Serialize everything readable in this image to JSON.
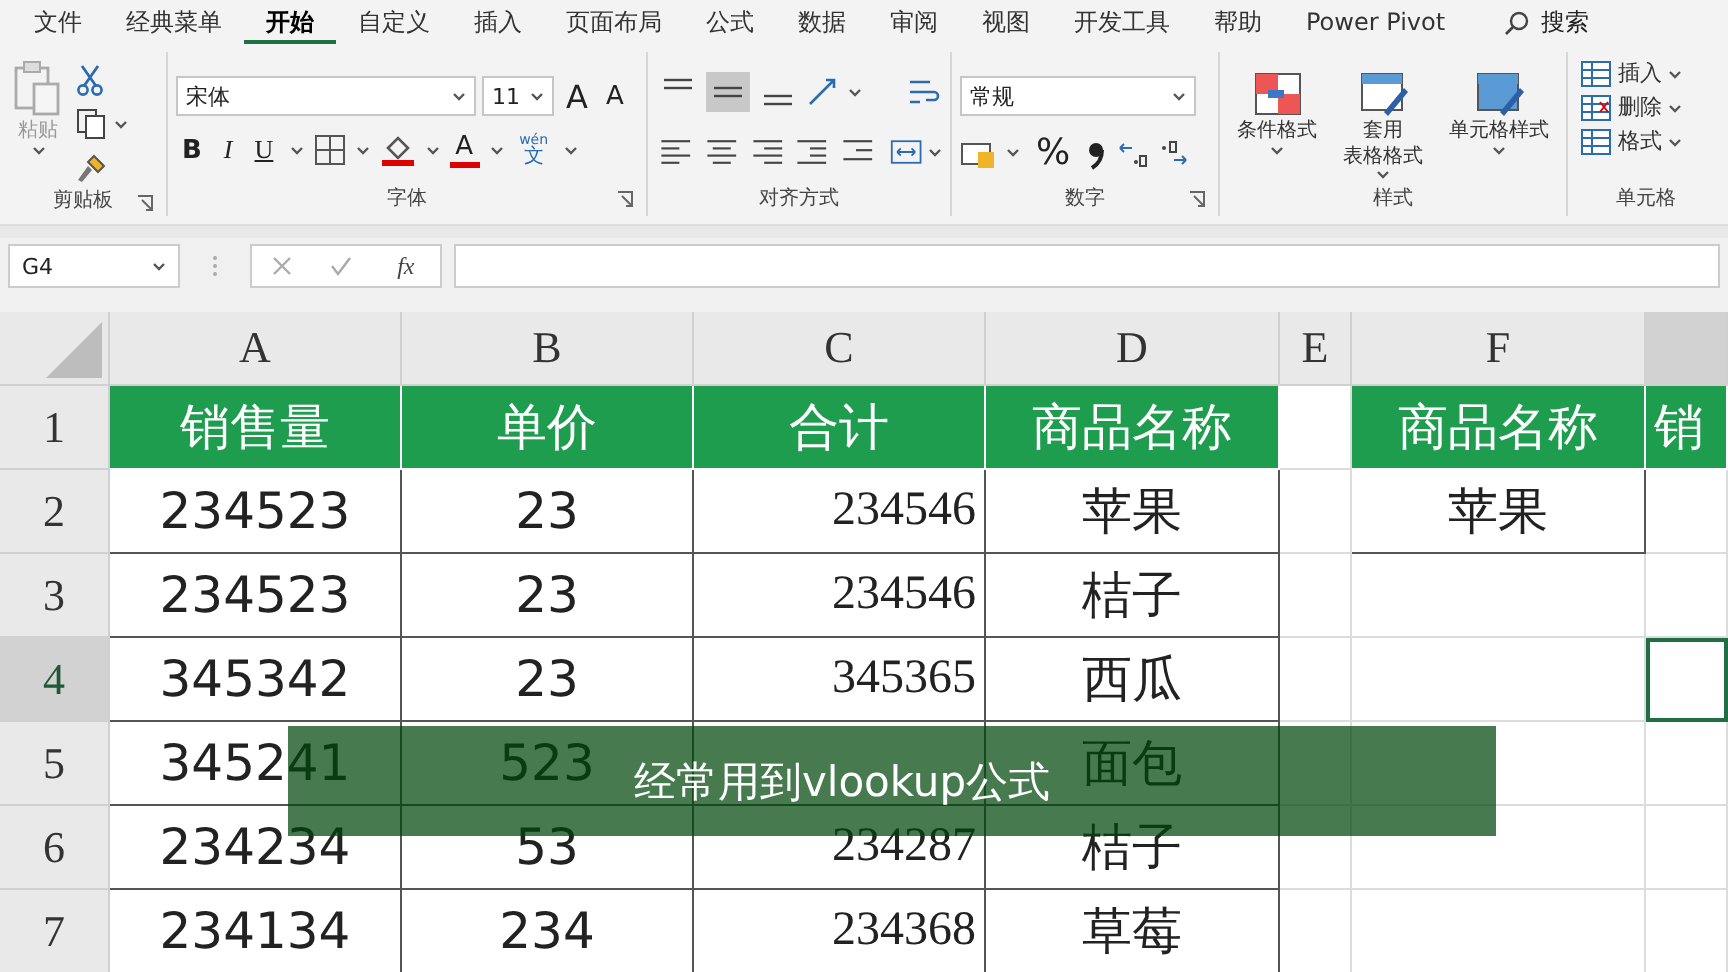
{
  "tabs": [
    {
      "label": "文件",
      "selected": false
    },
    {
      "label": "经典菜单",
      "selected": false
    },
    {
      "label": "开始",
      "selected": true
    },
    {
      "label": "自定义",
      "selected": false
    },
    {
      "label": "插入",
      "selected": false
    },
    {
      "label": "页面布局",
      "selected": false
    },
    {
      "label": "公式",
      "selected": false
    },
    {
      "label": "数据",
      "selected": false
    },
    {
      "label": "审阅",
      "selected": false
    },
    {
      "label": "视图",
      "selected": false
    },
    {
      "label": "开发工具",
      "selected": false
    },
    {
      "label": "帮助",
      "selected": false
    },
    {
      "label": "Power Pivot",
      "selected": false
    }
  ],
  "search": {
    "label": "搜索"
  },
  "ribbon": {
    "clipboard": {
      "title": "剪贴板",
      "paste_label": "粘贴",
      "paste_disabled": true
    },
    "font": {
      "title": "字体",
      "font_name": "宋体",
      "font_size": "11",
      "grow": "A",
      "shrink": "A",
      "bold": "B",
      "italic": "I",
      "underline": "U",
      "font_color": "A",
      "phonetic_top": "wén",
      "phonetic_bottom": "文"
    },
    "alignment": {
      "title": "对齐方式",
      "vertical": [
        {
          "selected": false
        },
        {
          "selected": true
        },
        {
          "selected": false
        }
      ]
    },
    "number": {
      "title": "数字",
      "format": "常规",
      "percent": "%"
    },
    "styles": {
      "title": "样式",
      "buttons": [
        {
          "lines": [
            "条件格式"
          ]
        },
        {
          "lines": [
            "套用",
            "表格格式"
          ]
        },
        {
          "lines": [
            "单元格样式"
          ]
        }
      ]
    },
    "cells": {
      "title": "单元格",
      "buttons": [
        {
          "label": "插入"
        },
        {
          "label": "删除"
        },
        {
          "label": "格式"
        }
      ]
    }
  },
  "formula_bar": {
    "name_box": "G4",
    "fx": "fx"
  },
  "sheet": {
    "columns": [
      {
        "label": "A",
        "selected": false
      },
      {
        "label": "B",
        "selected": false
      },
      {
        "label": "C",
        "selected": false
      },
      {
        "label": "D",
        "selected": false
      },
      {
        "label": "E",
        "selected": false
      },
      {
        "label": "F",
        "selected": false
      },
      {
        "selected": true
      }
    ],
    "rows": [
      {
        "number": "1",
        "kind": "header",
        "selected": false,
        "cells": [
          "销售量",
          "单价",
          "合计",
          "商品名称",
          null,
          "商品名称",
          "销"
        ]
      },
      {
        "number": "2",
        "kind": "data",
        "selected": false,
        "cells": [
          "234523",
          "23",
          "234546",
          "苹果",
          null,
          "苹果",
          null
        ]
      },
      {
        "number": "3",
        "kind": "data",
        "selected": false,
        "cells": [
          "234523",
          "23",
          "234546",
          "桔子",
          null,
          null,
          null
        ]
      },
      {
        "number": "4",
        "kind": "data",
        "selected": true,
        "cells": [
          "345342",
          "23",
          "345365",
          "西瓜",
          null,
          null,
          null
        ]
      },
      {
        "number": "5",
        "kind": "data",
        "selected": false,
        "cells": [
          "345241",
          "523",
          null,
          "面包",
          null,
          null,
          null
        ]
      },
      {
        "number": "6",
        "kind": "data",
        "selected": false,
        "cells": [
          "234234",
          "53",
          "234287",
          "桔子",
          null,
          null,
          null
        ]
      },
      {
        "number": "7",
        "kind": "data",
        "selected": false,
        "cells": [
          "234134",
          "234",
          "234368",
          "草莓",
          null,
          null,
          null
        ]
      }
    ]
  },
  "subtitle": "经常用到vlookup公式"
}
